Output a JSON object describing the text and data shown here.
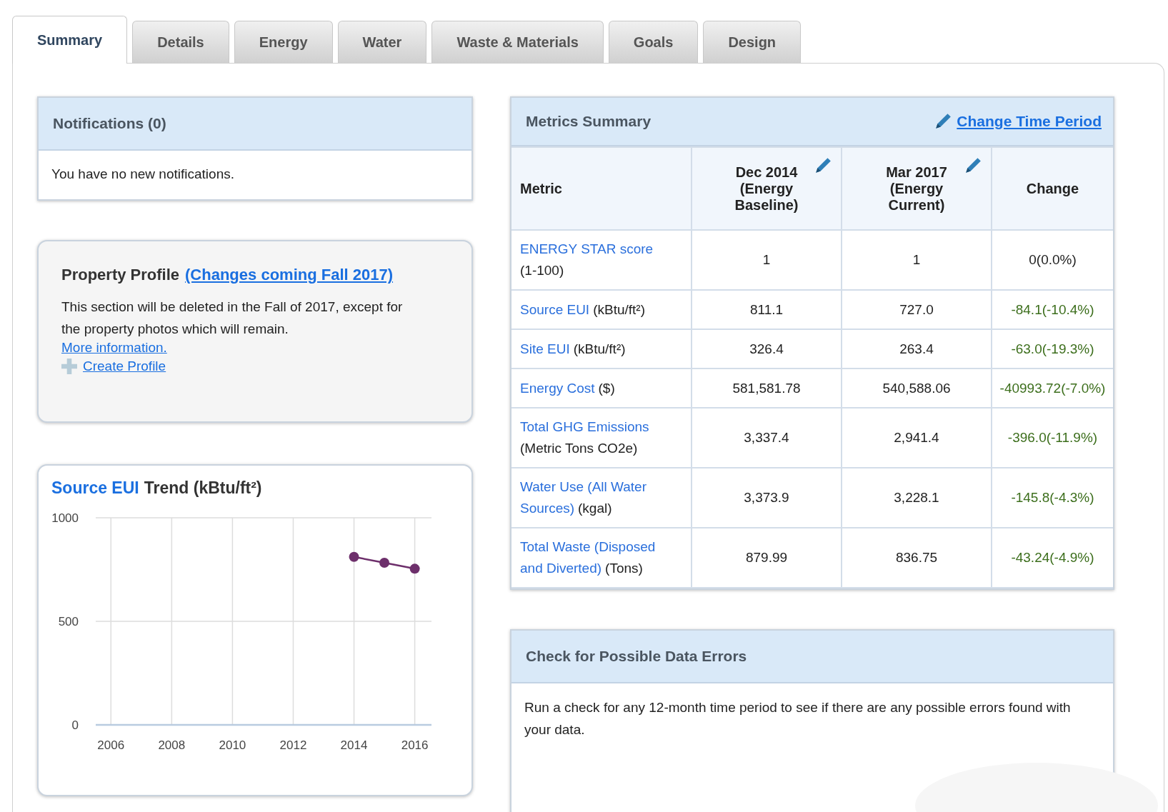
{
  "tabs": [
    {
      "label": "Summary",
      "selected": true
    },
    {
      "label": "Details",
      "selected": false
    },
    {
      "label": "Energy",
      "selected": false
    },
    {
      "label": "Water",
      "selected": false
    },
    {
      "label": "Waste & Materials",
      "selected": false
    },
    {
      "label": "Goals",
      "selected": false
    },
    {
      "label": "Design",
      "selected": false
    }
  ],
  "notifications": {
    "title": "Notifications (0)",
    "message": "You have no new notifications."
  },
  "property_profile": {
    "title": "Property Profile",
    "title_link": "(Changes coming Fall 2017)",
    "text": "This section will be deleted in the Fall of 2017, except for the property photos which will remain.",
    "more_link": "More information.",
    "create_link": "Create Profile"
  },
  "trend": {
    "title_link": "Source EUI",
    "title_rest": "Trend (kBtu/ft²)",
    "chart_data": {
      "type": "line",
      "x": [
        2014,
        2015,
        2016
      ],
      "series": [
        {
          "color": "#6d2f6b",
          "marker": true,
          "values": [
            811,
            783,
            754
          ]
        }
      ],
      "grid": true,
      "xlim": [
        2005.5,
        2016.55
      ],
      "ylim": [
        0,
        1000
      ],
      "xticks": [
        2006,
        2008,
        2010,
        2012,
        2014,
        2016
      ],
      "yticks": [
        0,
        500,
        1000
      ]
    }
  },
  "metrics": {
    "title": "Metrics Summary",
    "change_link": "Change Time Period",
    "columns": [
      {
        "lines": [
          "Metric"
        ],
        "editable": false
      },
      {
        "lines": [
          "Dec 2014",
          "(Energy",
          "Baseline)"
        ],
        "editable": true
      },
      {
        "lines": [
          "Mar 2017",
          "(Energy",
          "Current)"
        ],
        "editable": true
      },
      {
        "lines": [
          "Change"
        ],
        "editable": false
      }
    ],
    "rows": [
      {
        "lines": [
          [
            {
              "text": "ENERGY STAR score",
              "link": true
            }
          ],
          [
            {
              "text": "(1-100)",
              "link": false
            }
          ]
        ],
        "baseline": "1",
        "current": "1",
        "change": "0(0.0%)",
        "improved": false
      },
      {
        "lines": [
          [
            {
              "text": "Source EUI",
              "link": true
            },
            {
              "text": "(kBtu/ft²)",
              "link": false
            }
          ]
        ],
        "baseline": "811.1",
        "current": "727.0",
        "change": "-84.1(-10.4%)",
        "improved": true
      },
      {
        "lines": [
          [
            {
              "text": "Site EUI",
              "link": true
            },
            {
              "text": "(kBtu/ft²)",
              "link": false
            }
          ]
        ],
        "baseline": "326.4",
        "current": "263.4",
        "change": "-63.0(-19.3%)",
        "improved": true
      },
      {
        "lines": [
          [
            {
              "text": "Energy Cost",
              "link": true
            },
            {
              "text": "($)",
              "link": false
            }
          ]
        ],
        "baseline": "581,581.78",
        "current": "540,588.06",
        "change": "-40993.72(-7.0%)",
        "improved": true
      },
      {
        "lines": [
          [
            {
              "text": "Total GHG Emissions",
              "link": true
            }
          ],
          [
            {
              "text": "(Metric Tons CO2e)",
              "link": false
            }
          ]
        ],
        "baseline": "3,337.4",
        "current": "2,941.4",
        "change": "-396.0(-11.9%)",
        "improved": true
      },
      {
        "lines": [
          [
            {
              "text": "Water Use (All Water",
              "link": true
            }
          ],
          [
            {
              "text": "Sources)",
              "link": true
            },
            {
              "text": "(kgal)",
              "link": false
            }
          ]
        ],
        "baseline": "3,373.9",
        "current": "3,228.1",
        "change": "-145.8(-4.3%)",
        "improved": true
      },
      {
        "lines": [
          [
            {
              "text": "Total Waste (Disposed",
              "link": true
            }
          ],
          [
            {
              "text": "and Diverted)",
              "link": true
            },
            {
              "text": "(Tons)",
              "link": false
            }
          ]
        ],
        "baseline": "879.99",
        "current": "836.75",
        "change": "-43.24(-4.9%)",
        "improved": true
      }
    ]
  },
  "data_errors": {
    "title": "Check for Possible Data Errors",
    "text": "Run a check for any 12-month time period to see if there are any possible errors found with your data."
  }
}
